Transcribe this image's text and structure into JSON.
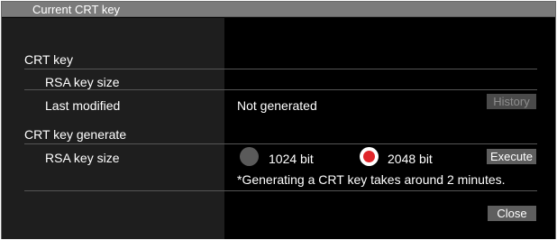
{
  "window": {
    "title": "Current CRT key"
  },
  "crt_key": {
    "heading": "CRT key",
    "rsa_key_size_label": "RSA key size",
    "rsa_key_size_value": "",
    "last_modified_label": "Last modified",
    "last_modified_value": "Not generated",
    "history_button": "History"
  },
  "crt_key_generate": {
    "heading": "CRT key generate",
    "rsa_key_size_label": "RSA key size",
    "options": [
      {
        "label": "1024 bit",
        "selected": false
      },
      {
        "label": "2048 bit",
        "selected": true
      }
    ],
    "execute_button": "Execute",
    "note": "*Generating a CRT key takes around 2 minutes."
  },
  "close_button": "Close",
  "colors": {
    "radio_selected": "#e0262b",
    "button_bg": "#5e5e5e",
    "title_bar": "#7b7b7b"
  }
}
